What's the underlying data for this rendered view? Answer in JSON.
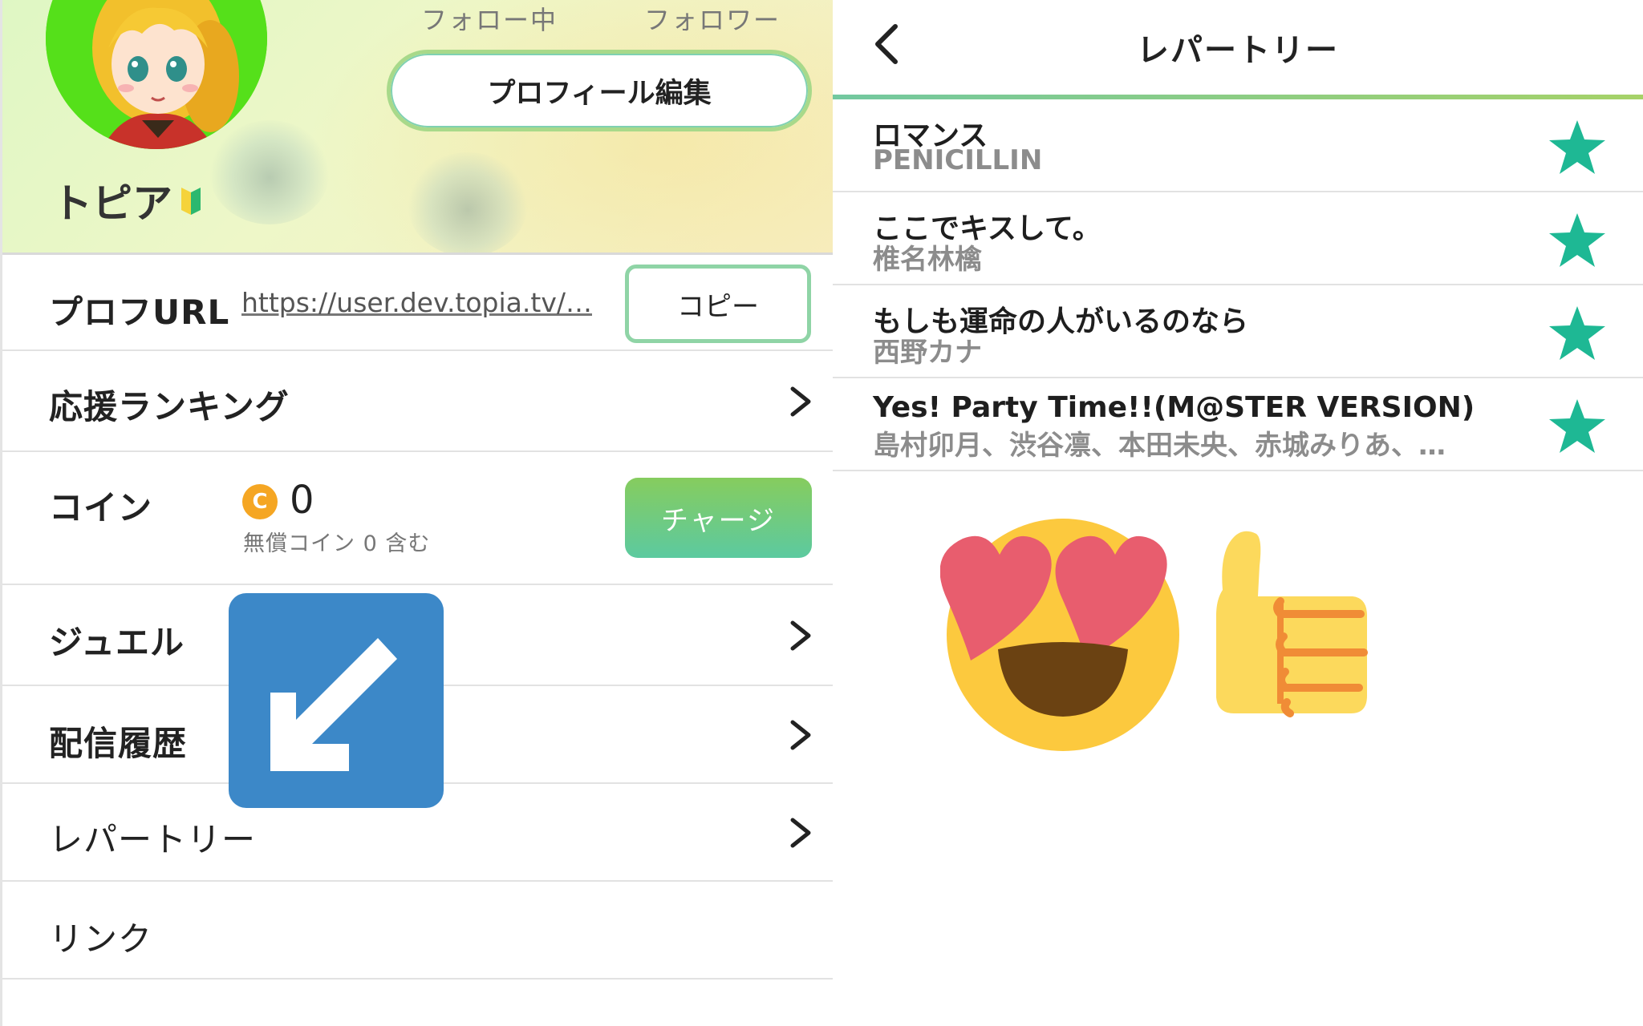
{
  "profile": {
    "following_label": "フォロー中",
    "followers_label": "フォロワー",
    "edit_button": "プロフィール編集",
    "username": "トピア"
  },
  "menu": {
    "prof_url_label": "プロフURL",
    "prof_url_value": "https://user.dev.topia.tv/…",
    "copy_button": "コピー",
    "ranking_label": "応援ランキング",
    "coin_label": "コイン",
    "coin_icon_letter": "C",
    "coin_count": "0",
    "coin_sub": "無償コイン 0 含む",
    "charge_button": "チャージ",
    "jewel_label": "ジュエル",
    "history_label": "配信履歴",
    "repertoire_label": "レパートリー",
    "link_label": "リンク"
  },
  "repertoire": {
    "title": "レパートリー",
    "songs": [
      {
        "title": "ロマンス",
        "artist": "PENICILLIN"
      },
      {
        "title": "ここでキスして。",
        "artist": "椎名林檎"
      },
      {
        "title": "もしも運命の人がいるのなら",
        "artist": "西野カナ"
      },
      {
        "title": "Yes! Party Time!!(M@STER VERSION)",
        "artist": "島村卯月、渋谷凛、本田未央、赤城みりあ、…"
      }
    ]
  },
  "icons": {
    "back": "chevron-left-icon",
    "chevron": "chevron-right-icon",
    "star": "star-icon",
    "arrow": "arrow-down-left-icon",
    "beginner": "beginner-mark-icon",
    "emoji_face": "heart-eyes-emoji",
    "emoji_thumb": "thumbs-up-emoji"
  },
  "colors": {
    "accent_green": "#8fd4a6",
    "teal_star": "#1eb894",
    "arrow_blue": "#3c88c8",
    "coin_orange": "#f5a623"
  }
}
